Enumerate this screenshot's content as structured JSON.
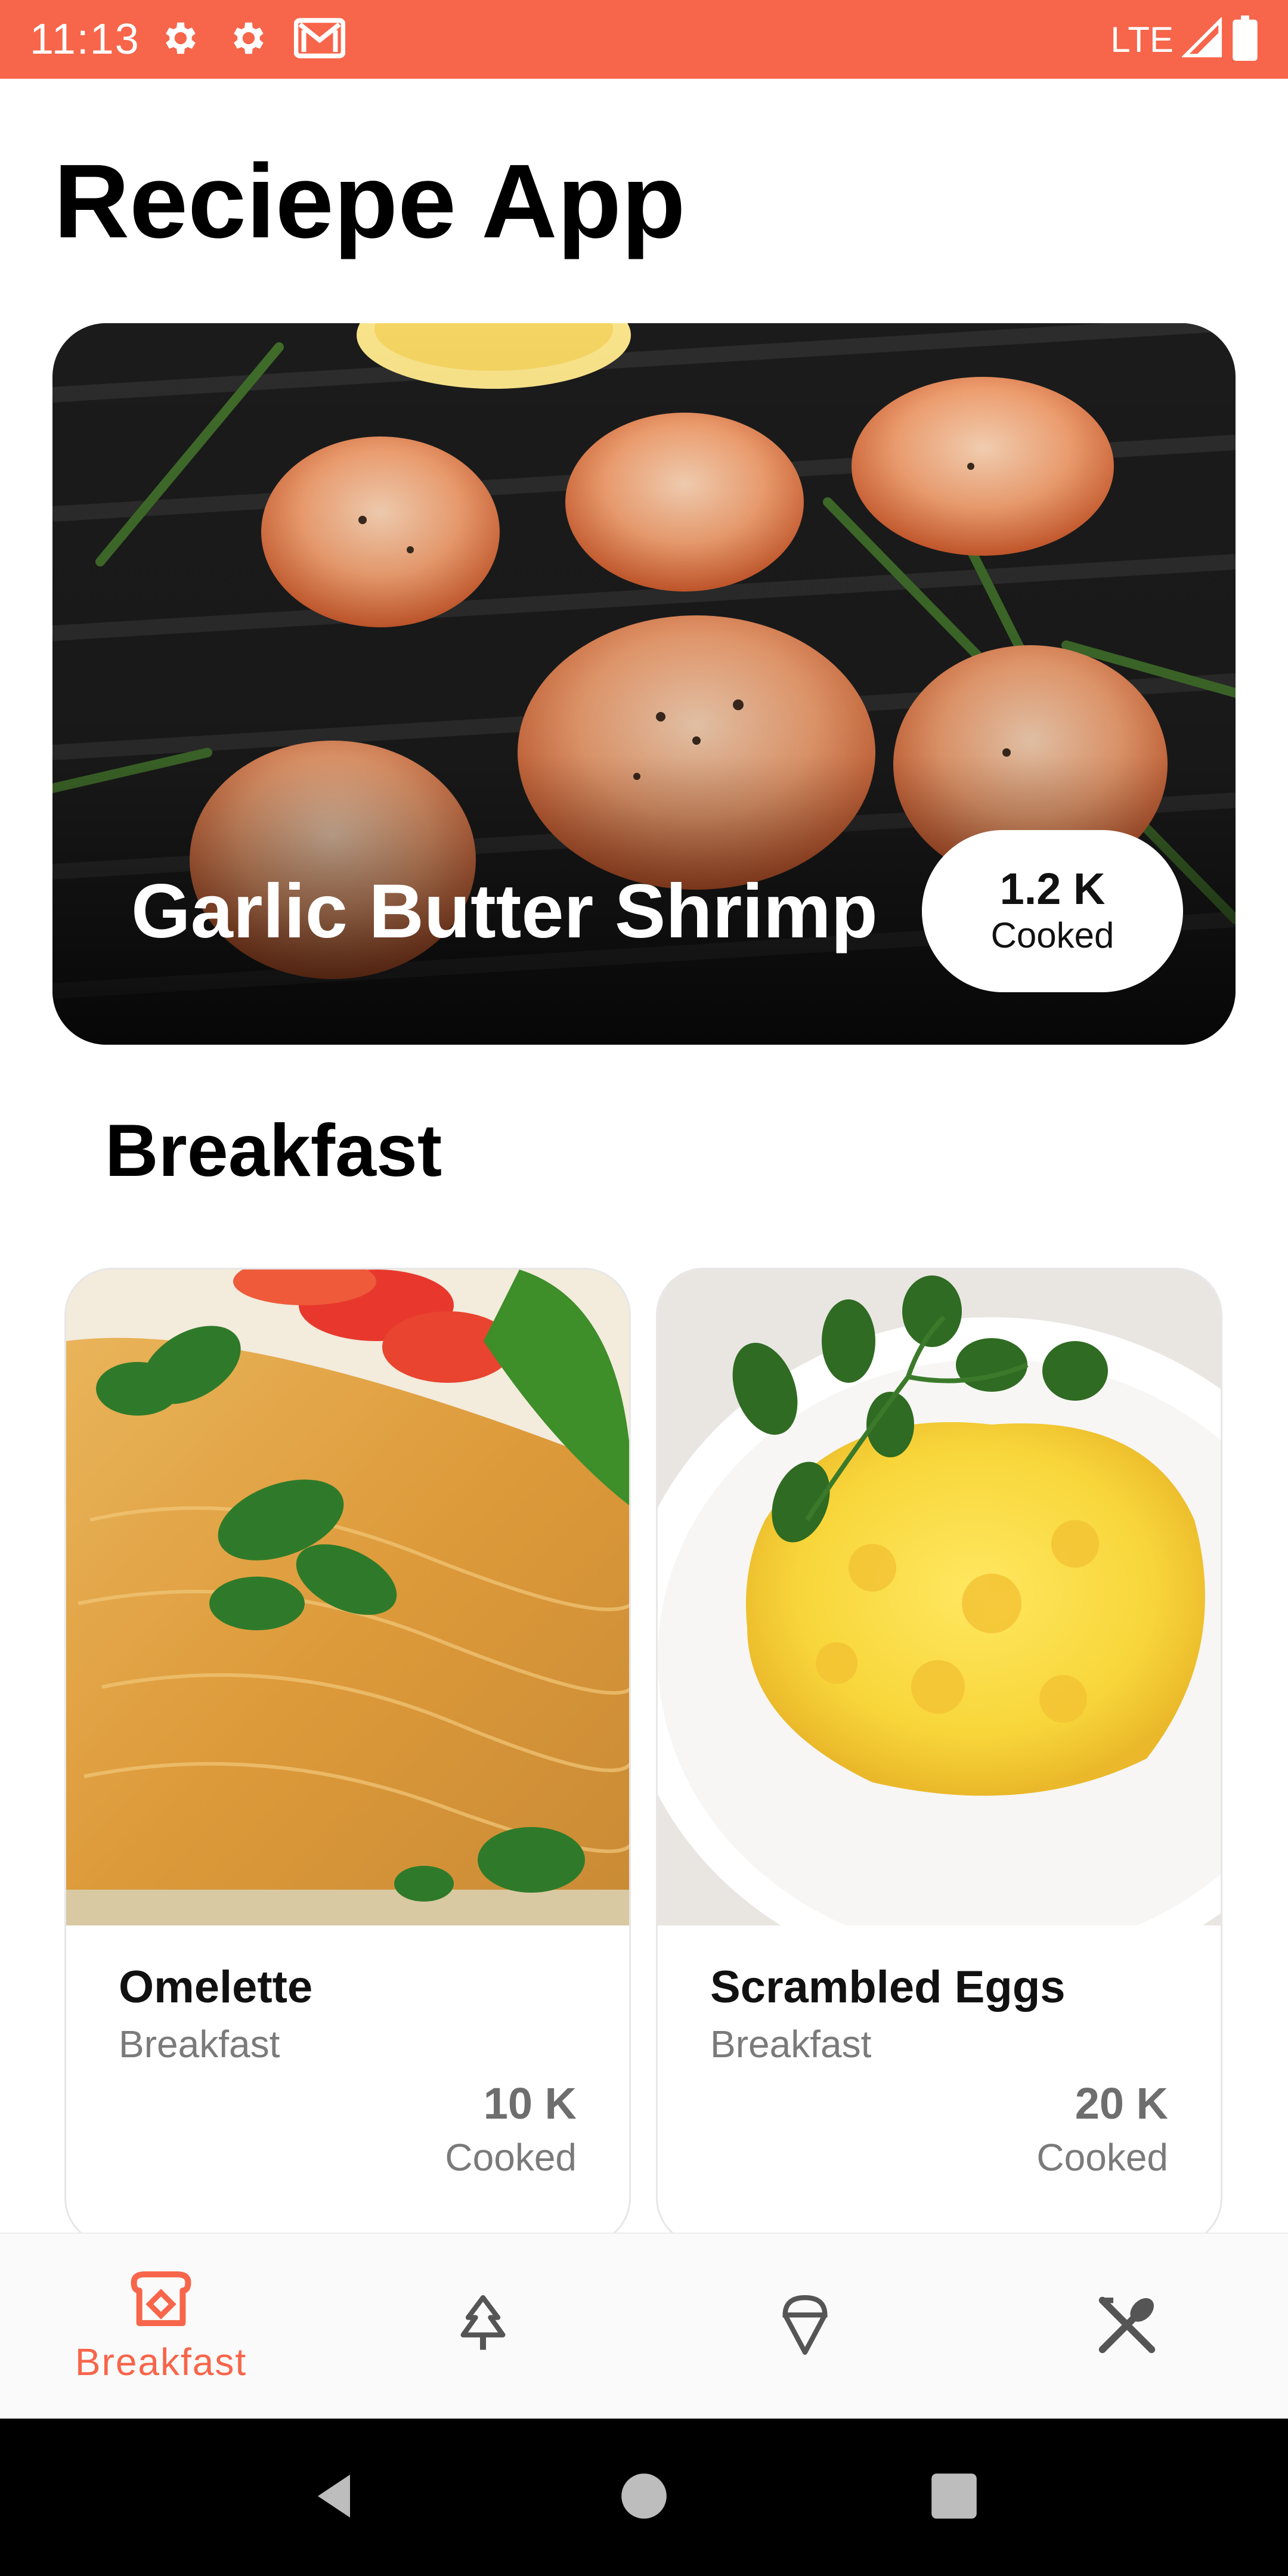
{
  "status_bar": {
    "time": "11:13",
    "network": "LTE",
    "icons": [
      "gear-icon",
      "gear-icon",
      "gmail-icon",
      "signal-icon",
      "battery-icon"
    ]
  },
  "app": {
    "title": "Reciepe App"
  },
  "featured": {
    "title": "Garlic Butter Shrimp",
    "cooked_count": "1.2 K",
    "cooked_label": "Cooked"
  },
  "section": {
    "title": "Breakfast"
  },
  "recipes": [
    {
      "name": "Omelette",
      "category": "Breakfast",
      "count": "10 K",
      "count_label": "Cooked"
    },
    {
      "name": "Scrambled Eggs",
      "category": "Breakfast",
      "count": "20 K",
      "count_label": "Cooked"
    }
  ],
  "bottom_nav": {
    "items": [
      {
        "icon": "toast-icon",
        "label": "Breakfast",
        "active": true
      },
      {
        "icon": "tree-icon",
        "label": "",
        "active": false
      },
      {
        "icon": "ice-cream-icon",
        "label": "",
        "active": false
      },
      {
        "icon": "fork-spoon-icon",
        "label": "",
        "active": false
      }
    ]
  },
  "colors": {
    "accent": "#f7654a",
    "inactive_icon": "#555555"
  }
}
